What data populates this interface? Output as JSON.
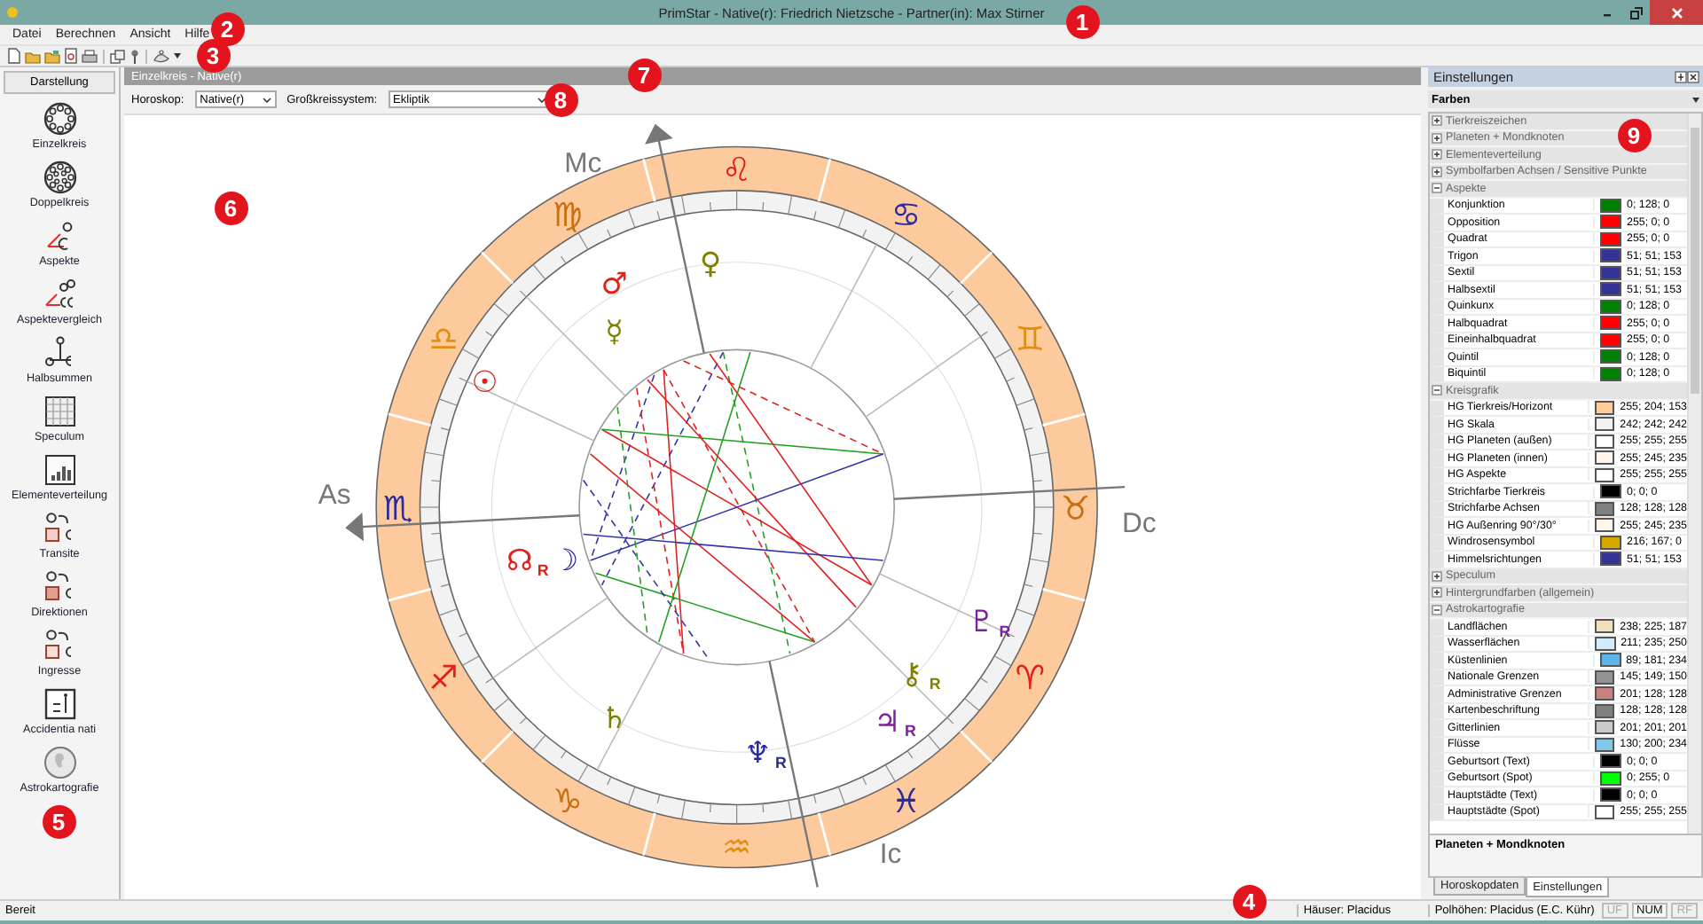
{
  "window": {
    "title": "PrimStar - Native(r): Friedrich Nietzsche - Partner(in): Max Stirner"
  },
  "menu": [
    "Datei",
    "Berechnen",
    "Ansicht",
    "Hilfe"
  ],
  "sidebar": {
    "title": "Darstellung",
    "items": [
      "Einzelkreis",
      "Doppelkreis",
      "Aspekte",
      "Aspektevergleich",
      "Halbsummen",
      "Speculum",
      "Elementeverteilung",
      "Transite",
      "Direktionen",
      "Ingresse",
      "Accidentia nati",
      "Astrokartografie"
    ]
  },
  "document": {
    "title": "Einzelkreis - Native(r)",
    "options": [
      {
        "label": "Horoskop:",
        "value": "Native(r)"
      },
      {
        "label": "Großkreissystem:",
        "value": "Ekliptik"
      }
    ]
  },
  "chart": {
    "signs": [
      {
        "glyph": "♈",
        "color": "#e0201a"
      },
      {
        "glyph": "♉",
        "color": "#c87010"
      },
      {
        "glyph": "♊",
        "color": "#e09010"
      },
      {
        "glyph": "♋",
        "color": "#2a2aa0"
      },
      {
        "glyph": "♌",
        "color": "#e0201a"
      },
      {
        "glyph": "♍",
        "color": "#c87010"
      },
      {
        "glyph": "♎",
        "color": "#e09010"
      },
      {
        "glyph": "♏",
        "color": "#2a2aa0"
      },
      {
        "glyph": "♐",
        "color": "#e0201a"
      },
      {
        "glyph": "♑",
        "color": "#c87010"
      },
      {
        "glyph": "♒",
        "color": "#e09010"
      },
      {
        "glyph": "♓",
        "color": "#2a2aa0"
      }
    ],
    "axes": [
      {
        "label": "Dc"
      },
      {
        "label": "Mc"
      },
      {
        "label": "As"
      },
      {
        "label": "Ic"
      }
    ],
    "planets": [
      {
        "glyph": "♀",
        "color": "#808000"
      },
      {
        "glyph": "♂",
        "color": "#e0201a"
      },
      {
        "glyph": "☿",
        "color": "#808000"
      },
      {
        "glyph": "☉",
        "color": "#e0201a"
      },
      {
        "glyph": "☊",
        "color": "#e0201a",
        "retro": "R"
      },
      {
        "glyph": "☽",
        "color": "#2a2aa0"
      },
      {
        "glyph": "♇",
        "color": "#8020a0",
        "retro": "R"
      },
      {
        "glyph": "⚷",
        "color": "#808000",
        "retro": "R"
      },
      {
        "glyph": "♃",
        "color": "#8020a0",
        "retro": "R"
      },
      {
        "glyph": "♄",
        "color": "#808000"
      },
      {
        "glyph": "♆",
        "color": "#2a2aa0",
        "retro": "R"
      }
    ]
  },
  "settings_panel": {
    "title": "Einstellungen",
    "category": "Farben",
    "groups": [
      {
        "name": "Tierkreiszeichen",
        "expanded": false
      },
      {
        "name": "Planeten + Mondknoten",
        "expanded": false
      },
      {
        "name": "Elementeverteilung",
        "expanded": false
      },
      {
        "name": "Symbolfarben Achsen / Sensitive Punkte",
        "expanded": false
      },
      {
        "name": "Aspekte",
        "expanded": true,
        "items": [
          {
            "name": "Konjunktion",
            "value": "0; 128; 0",
            "color": "#008000"
          },
          {
            "name": "Opposition",
            "value": "255; 0; 0",
            "color": "#ff0000"
          },
          {
            "name": "Quadrat",
            "value": "255; 0; 0",
            "color": "#ff0000"
          },
          {
            "name": "Trigon",
            "value": "51; 51; 153",
            "color": "#333399"
          },
          {
            "name": "Sextil",
            "value": "51; 51; 153",
            "color": "#333399"
          },
          {
            "name": "Halbsextil",
            "value": "51; 51; 153",
            "color": "#333399"
          },
          {
            "name": "Quinkunx",
            "value": "0; 128; 0",
            "color": "#008000"
          },
          {
            "name": "Halbquadrat",
            "value": "255; 0; 0",
            "color": "#ff0000"
          },
          {
            "name": "Eineinhalbquadrat",
            "value": "255; 0; 0",
            "color": "#ff0000"
          },
          {
            "name": "Quintil",
            "value": "0; 128; 0",
            "color": "#008000"
          },
          {
            "name": "Biquintil",
            "value": "0; 128; 0",
            "color": "#008000"
          }
        ]
      },
      {
        "name": "Kreisgrafik",
        "expanded": true,
        "items": [
          {
            "name": "HG Tierkreis/Horizont",
            "value": "255; 204; 153",
            "color": "#ffcc99"
          },
          {
            "name": "HG Skala",
            "value": "242; 242; 242",
            "color": "#f2f2f2"
          },
          {
            "name": "HG Planeten (außen)",
            "value": "255; 255; 255",
            "color": "#ffffff"
          },
          {
            "name": "HG Planeten (innen)",
            "value": "255; 245; 235",
            "color": "#fff5eb"
          },
          {
            "name": "HG Aspekte",
            "value": "255; 255; 255",
            "color": "#ffffff"
          },
          {
            "name": "Strichfarbe Tierkreis",
            "value": "0; 0; 0",
            "color": "#000000"
          },
          {
            "name": "Strichfarbe Achsen",
            "value": "128; 128; 128",
            "color": "#808080"
          },
          {
            "name": "HG Außenring 90°/30°",
            "value": "255; 245; 235",
            "color": "#fff5eb"
          },
          {
            "name": "Windrosensymbol",
            "value": "216; 167; 0",
            "color": "#d8a700"
          },
          {
            "name": "Himmelsrichtungen",
            "value": "51; 51; 153",
            "color": "#333399"
          }
        ]
      },
      {
        "name": "Speculum",
        "expanded": false
      },
      {
        "name": "Hintergrundfarben (allgemein)",
        "expanded": false
      },
      {
        "name": "Astrokartografie",
        "expanded": true,
        "items": [
          {
            "name": "Landflächen",
            "value": "238; 225; 187",
            "color": "#eee1bb"
          },
          {
            "name": "Wasserflächen",
            "value": "211; 235; 250",
            "color": "#d3ebfa"
          },
          {
            "name": "Küstenlinien",
            "value": "89; 181; 234",
            "color": "#59b5ea"
          },
          {
            "name": "Nationale Grenzen",
            "value": "145; 149; 150",
            "color": "#919596"
          },
          {
            "name": "Administrative Grenzen",
            "value": "201; 128; 128",
            "color": "#c98080"
          },
          {
            "name": "Kartenbeschriftung",
            "value": "128; 128; 128",
            "color": "#808080"
          },
          {
            "name": "Gitterlinien",
            "value": "201; 201; 201",
            "color": "#c9c9c9"
          },
          {
            "name": "Flüsse",
            "value": "130; 200; 234",
            "color": "#82c8ea"
          },
          {
            "name": "Geburtsort (Text)",
            "value": "0; 0; 0",
            "color": "#000000"
          },
          {
            "name": "Geburtsort (Spot)",
            "value": "0; 255; 0",
            "color": "#00ff00"
          },
          {
            "name": "Hauptstädte (Text)",
            "value": "0; 0; 0",
            "color": "#000000"
          },
          {
            "name": "Hauptstädte (Spot)",
            "value": "255; 255; 255",
            "color": "#ffffff"
          }
        ]
      }
    ],
    "description": "Planeten + Mondknoten",
    "tabs": [
      {
        "label": "Horoskopdaten",
        "selected": false
      },
      {
        "label": "Einstellungen",
        "selected": true
      }
    ]
  },
  "status_bar": {
    "message": "Bereit",
    "fields": [
      "Häuser: Placidus",
      "Polhöhen: Placidus (E.C. Kühr)"
    ],
    "indicators": [
      {
        "label": "UF",
        "on": false
      },
      {
        "label": "NUM",
        "on": true
      },
      {
        "label": "RF",
        "on": false
      }
    ]
  },
  "callouts": [
    "1",
    "2",
    "3",
    "4",
    "5",
    "6",
    "7",
    "8",
    "9"
  ]
}
